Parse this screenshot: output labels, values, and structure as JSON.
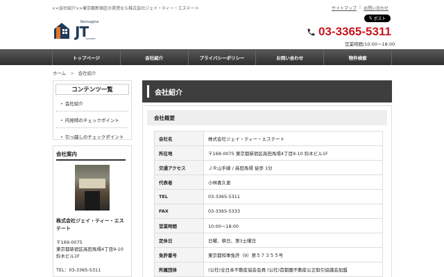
{
  "header": {
    "breadcrumb_text": "<<会社紹介>>東京都新宿区の賃貸なら株式会社ジェイ・ティー・エステート",
    "links": [
      "サイトマップ",
      "お問い合わせ"
    ],
    "post_label": "ポスト",
    "logo_top": "Reimagine",
    "logo_main": "JT",
    "logo_bottom": "Connect",
    "phone": "03-3365-5311",
    "hours": "営業時間/10:00～18:00"
  },
  "nav": {
    "items": [
      "トップページ",
      "会社紹介",
      "プライバシーポリシー",
      "お問い合わせ",
      "物件検索"
    ]
  },
  "breadcrumb": {
    "home": "ホーム",
    "arrow": ">",
    "current": "会社紹介"
  },
  "sidebar": {
    "menu_title": "コンテンツ一覧",
    "items": [
      "会社紹介",
      "内見時のチェックポイント",
      "引っ越しのチェックポイント"
    ],
    "info_title": "会社案内",
    "shop_name": "株式会社ジェイ・ティー・エステート",
    "postal": "〒169-0075",
    "address": "東京都新宿区高田馬場4丁目9-10 鈴木ビル1F",
    "tel": "TEL：03-3365-5311"
  },
  "main": {
    "title": "会社紹介",
    "section_title": "会社概要",
    "rows": [
      {
        "key": "会社名",
        "value": "株式会社ジェイ・ティー・エステート"
      },
      {
        "key": "所在地",
        "value": "〒169-0075 東京都新宿区高田馬場4丁目9-10 鈴木ビル1F"
      },
      {
        "key": "交通アクセス",
        "value": "ＪＲ山手線 / 高田馬場 徒歩 1分"
      },
      {
        "key": "代表者",
        "value": "小林喜久恵"
      },
      {
        "key": "TEL",
        "value": "03-3365-5311"
      },
      {
        "key": "FAX",
        "value": "03-3365-5333"
      },
      {
        "key": "営業時間",
        "value": "10:00～18:00"
      },
      {
        "key": "定休日",
        "value": "日曜、祭日、第3土曜日"
      },
      {
        "key": "免許番号",
        "value": "東京都知事免許（9）第５７３５５号"
      },
      {
        "key": "所属団体",
        "value": "(公社)全日本不動産協会会員 (公社)首都圏不動産公正取引協議会加盟"
      }
    ]
  },
  "colors": {
    "accent_red": "#c8161d",
    "nav_dark": "#2f2f2f",
    "brand_navy": "#1f3a5a",
    "logo_orange": "#e0782a"
  },
  "icons": [
    "phone-icon",
    "x-logo-icon"
  ]
}
